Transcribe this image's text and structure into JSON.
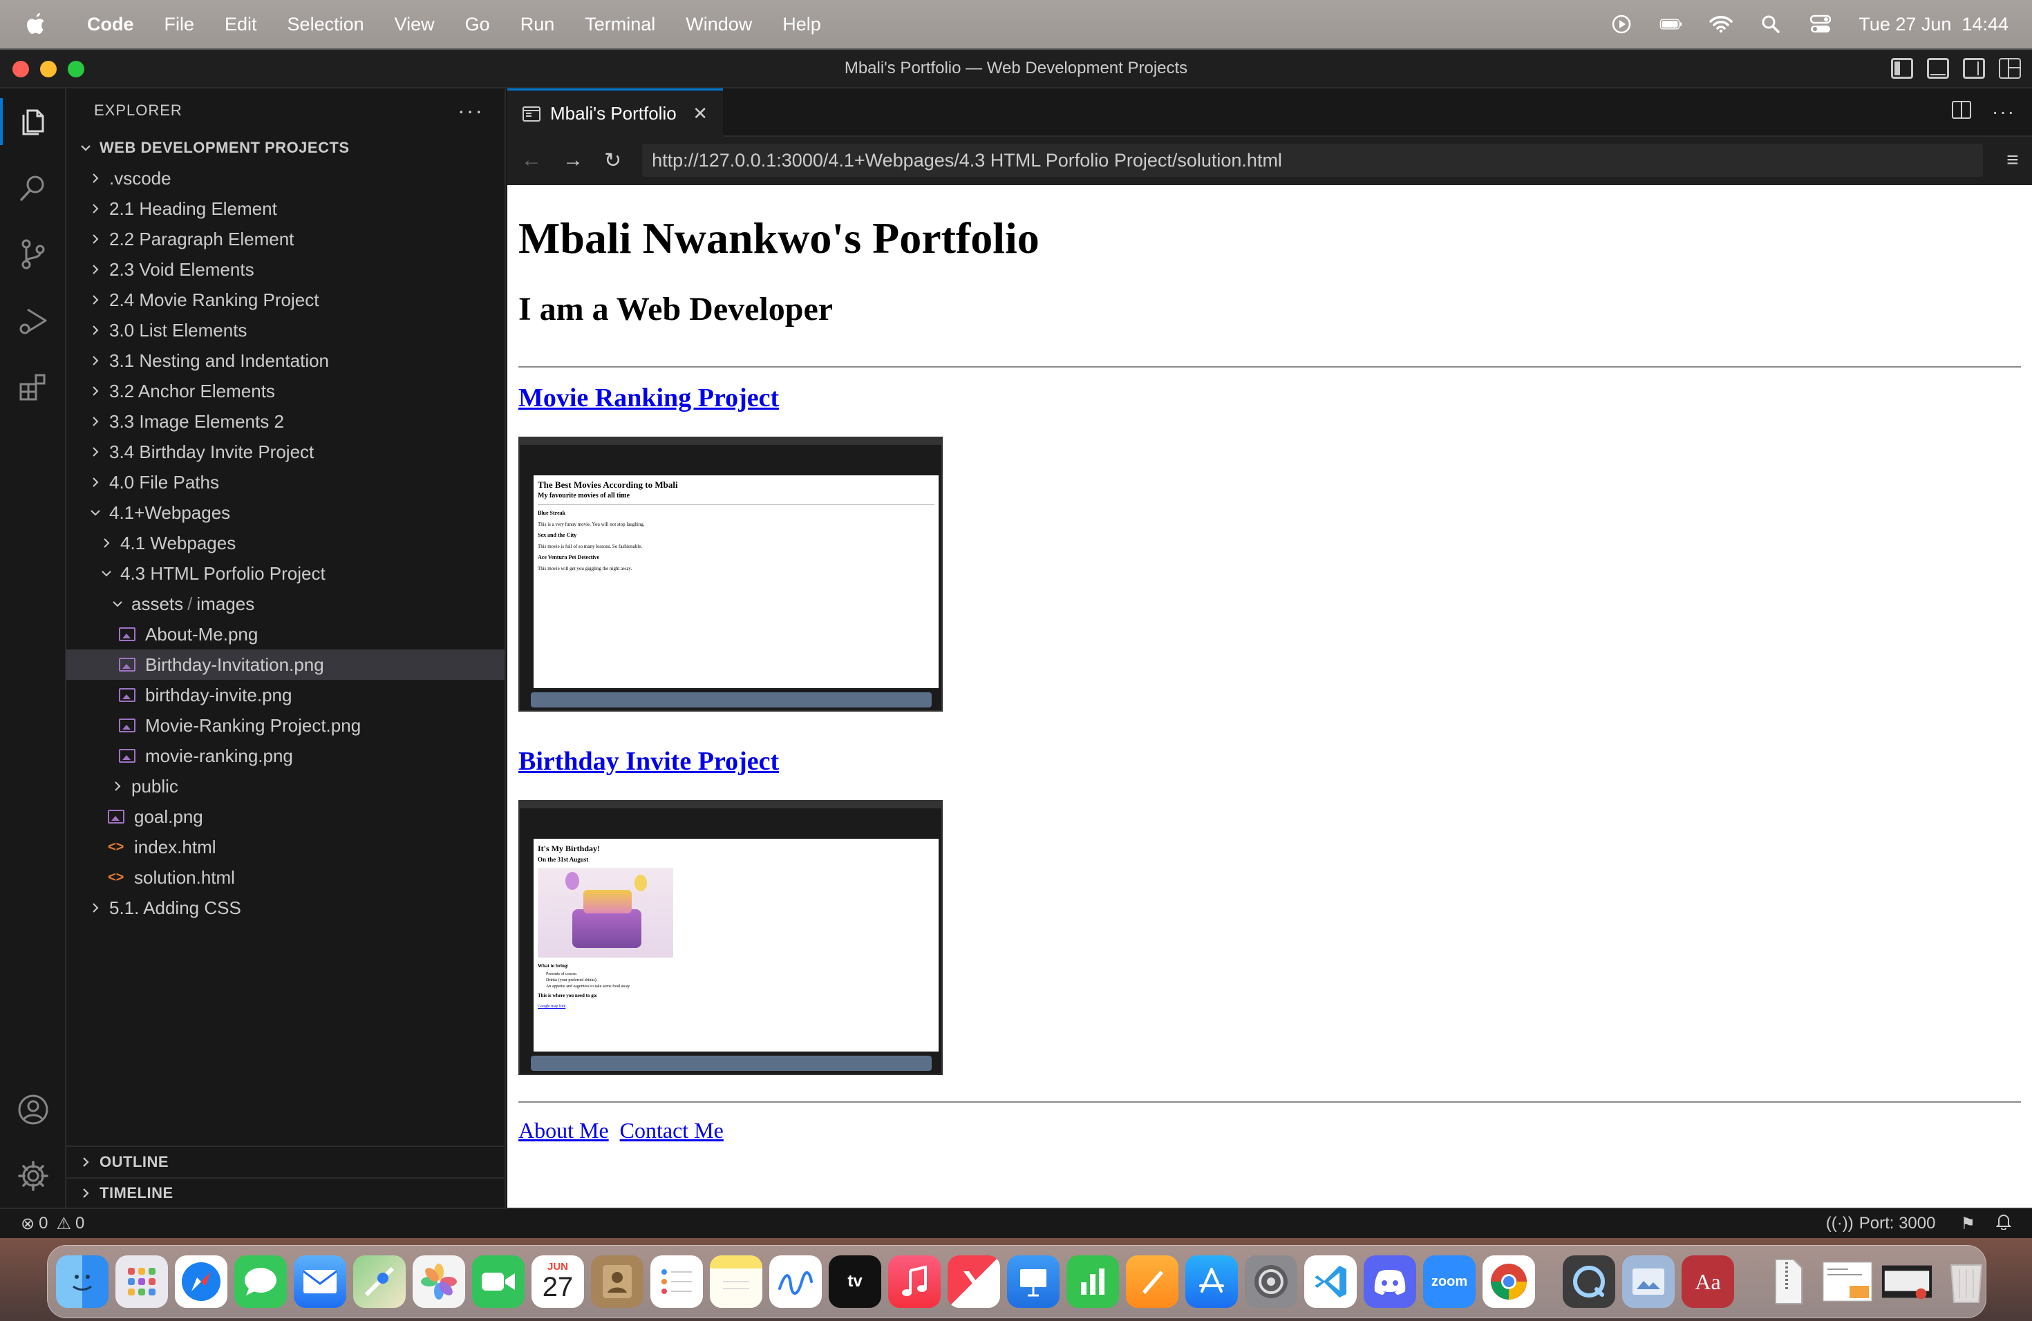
{
  "menubar": {
    "app": "Code",
    "items": [
      "File",
      "Edit",
      "Selection",
      "View",
      "Go",
      "Run",
      "Terminal",
      "Window",
      "Help"
    ],
    "clock": "Tue 27 Jun  14:44"
  },
  "window": {
    "title": "Mbali's Portfolio — Web Development Projects"
  },
  "sidebar": {
    "header": "EXPLORER",
    "root": "WEB DEVELOPMENT PROJECTS",
    "tree": [
      {
        "label": ".vscode",
        "type": "folder",
        "level": 0,
        "open": false
      },
      {
        "label": "2.1 Heading Element",
        "type": "folder",
        "level": 0,
        "open": false
      },
      {
        "label": "2.2 Paragraph Element",
        "type": "folder",
        "level": 0,
        "open": false
      },
      {
        "label": "2.3 Void Elements",
        "type": "folder",
        "level": 0,
        "open": false
      },
      {
        "label": "2.4 Movie Ranking Project",
        "type": "folder",
        "level": 0,
        "open": false
      },
      {
        "label": "3.0 List Elements",
        "type": "folder",
        "level": 0,
        "open": false
      },
      {
        "label": "3.1 Nesting and Indentation",
        "type": "folder",
        "level": 0,
        "open": false
      },
      {
        "label": "3.2 Anchor Elements",
        "type": "folder",
        "level": 0,
        "open": false
      },
      {
        "label": "3.3 Image Elements 2",
        "type": "folder",
        "level": 0,
        "open": false
      },
      {
        "label": "3.4 Birthday Invite Project",
        "type": "folder",
        "level": 0,
        "open": false
      },
      {
        "label": "4.0 File Paths",
        "type": "folder",
        "level": 0,
        "open": false
      },
      {
        "label": "4.1+Webpages",
        "type": "folder",
        "level": 0,
        "open": true
      },
      {
        "label": "4.1 Webpages",
        "type": "folder",
        "level": 1,
        "open": false
      },
      {
        "label": "4.3 HTML Porfolio Project",
        "type": "folder",
        "level": 1,
        "open": true
      },
      {
        "label": "assets",
        "label2": "images",
        "type": "folder",
        "level": 2,
        "open": true
      },
      {
        "label": "About-Me.png",
        "type": "image",
        "level": 3
      },
      {
        "label": "Birthday-Invitation.png",
        "type": "image",
        "level": 3,
        "selected": true
      },
      {
        "label": "birthday-invite.png",
        "type": "image",
        "level": 3
      },
      {
        "label": "Movie-Ranking Project.png",
        "type": "image",
        "level": 3
      },
      {
        "label": "movie-ranking.png",
        "type": "image",
        "level": 3
      },
      {
        "label": "public",
        "type": "folder",
        "level": 2,
        "open": false
      },
      {
        "label": "goal.png",
        "type": "image",
        "level": 2
      },
      {
        "label": "index.html",
        "type": "html",
        "level": 2
      },
      {
        "label": "solution.html",
        "type": "html",
        "level": 2
      },
      {
        "label": "5.1. Adding CSS",
        "type": "folder",
        "level": 0,
        "open": false
      }
    ],
    "outline": "OUTLINE",
    "timeline": "TIMELINE"
  },
  "editor": {
    "tab_label": "Mbali's Portfolio",
    "url": "http://127.0.0.1:3000/4.1+Webpages/4.3 HTML Porfolio Project/solution.html"
  },
  "webpage": {
    "h1": "Mbali Nwankwo's Portfolio",
    "h2": "I am a Web Developer",
    "project1": "Movie Ranking Project",
    "project2": "Birthday Invite Project",
    "footer_link1": "About Me",
    "footer_link2": "Contact Me",
    "thumb1": {
      "title": "The Best Movies According to Mbali",
      "subtitle": "My favourite movies of all time",
      "items": [
        {
          "name": "Blue Streak",
          "desc": "This is a very funny movie. You will not stop laughing."
        },
        {
          "name": "Sex and the City",
          "desc": "This movie is full of so many lessons. So fashionable."
        },
        {
          "name": "Ace Ventura Pet Detective",
          "desc": "This movie will get you giggling the night away."
        }
      ]
    },
    "thumb2": {
      "title": "It's My Birthday!",
      "subtitle": "On the 31st August",
      "bring": "What to bring:",
      "list": [
        "Presents of course.",
        "Drinks (your preferred drinks).",
        "An appetite and eagerness to take some food away."
      ],
      "where": "This is where you need to go:",
      "link": "Google map link"
    }
  },
  "statusbar": {
    "errors": "0",
    "warnings": "0",
    "port": "Port: 3000"
  },
  "dock": {
    "calendar_month": "JUN",
    "calendar_day": "27",
    "zoom_label": "zoom",
    "dictionary_label": "Aa",
    "apps": [
      "Finder",
      "Launchpad",
      "Safari",
      "Messages",
      "Mail",
      "Maps",
      "Photos",
      "FaceTime",
      "Calendar",
      "Contacts",
      "Reminders",
      "Notes",
      "Freeform",
      "TV",
      "Music",
      "News",
      "Keynote",
      "Numbers",
      "Pages",
      "App Store",
      "System Settings",
      "Visual Studio Code",
      "Discord",
      "Zoom",
      "Chrome",
      "QuickTime",
      "Preview",
      "Dictionary",
      "Archive",
      "Document",
      "Screenshot",
      "Trash"
    ],
    "colors": {
      "finder": "#2f8cf0",
      "launchpad": "#e8e8ee",
      "safari": "#1a7ff0",
      "messages": "#35c759",
      "mail": "#3a8df5",
      "maps": "#5fb36b",
      "photos": "#f4f4f4",
      "facetime": "#32c35a",
      "calendar": "#ffffff",
      "contacts": "#a78559",
      "reminders": "#ffffff",
      "notes": "#fbe36b",
      "freeform": "#ffffff",
      "tv": "#111111",
      "music": "#fa3c4c",
      "news": "#f6404f",
      "keynote": "#2d8ff1",
      "numbers": "#35c24e",
      "pages": "#ff9e1b",
      "appstore": "#1f8cf6",
      "settings": "#8a8a8f",
      "vscode": "#2c9ce8",
      "discord": "#5865f2",
      "zoom": "#2d8cff",
      "chrome": "#ffffff",
      "quicktime": "#3c3c3c",
      "preview": "#9fb8d9",
      "dictionary": "#b8323a"
    }
  }
}
